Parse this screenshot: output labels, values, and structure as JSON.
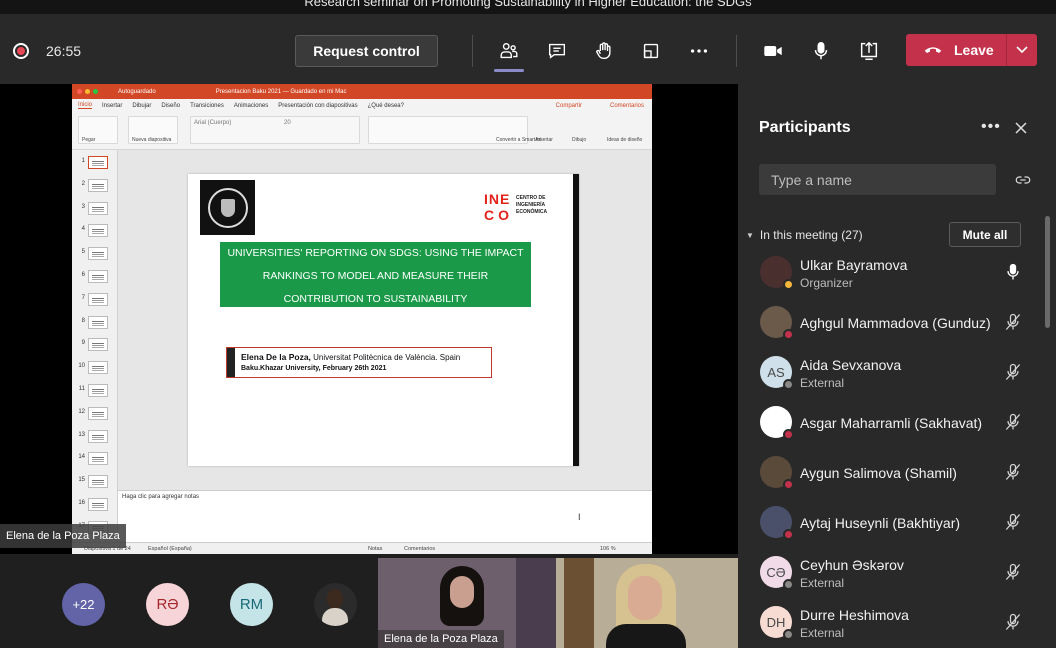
{
  "window": {
    "title": "Research seminar on Promoting Sustainability in Higher Education: the SDGs"
  },
  "toolbar": {
    "timer": "26:55",
    "request_control_label": "Request control",
    "leave_label": "Leave",
    "icons": [
      "people-icon",
      "chat-icon",
      "raise-hand-icon",
      "rooms-icon",
      "more-icon",
      "camera-icon",
      "mic-icon",
      "share-icon"
    ],
    "accent_color": "#6264a7",
    "leave_color": "#c4314b"
  },
  "presentation": {
    "autosave_label": "Autoguardado",
    "doc_title": "Presentacion Baku 2021 — Guardado en mi Mac",
    "tabs": [
      "Inicio",
      "Insertar",
      "Dibujar",
      "Diseño",
      "Transiciones",
      "Animaciones",
      "Presentación con diapositivas",
      "¿Qué desea?"
    ],
    "share_label": "Compartir",
    "comments_label": "Comentarios",
    "font_name": "Arial (Cuerpo)",
    "font_size": "20",
    "ribbon_labels": [
      "Pegar",
      "Nueva diapositiva",
      "Convertir a SmartArt",
      "Insertar",
      "Dibujo",
      "Ideas de diseño"
    ],
    "slide_numbers": [
      "1",
      "2",
      "3",
      "4",
      "5",
      "6",
      "7",
      "8",
      "9",
      "10",
      "11",
      "12",
      "13",
      "14",
      "15",
      "16",
      "17"
    ],
    "slide": {
      "logo_main_line1": "INE",
      "logo_main_line2": "CO",
      "logo_text": "CENTRO DE INGENIERÍA ECONÓMICA",
      "title": "UNIVERSITIES' REPORTING ON SDGS: USING THE IMPACT RANKINGS TO MODEL AND MEASURE THEIR CONTRIBUTION TO  SUSTAINABILITY",
      "author_name": "Elena De la Poza,",
      "author_affiliation": "Universitat Politècnica de València. Spain",
      "author_line2": "Baku.Khazar University, February 26th 2021",
      "green_color": "#1a9a48"
    },
    "notes_placeholder": "Haga clic para agregar notas",
    "status": {
      "slide_of": "Diapositiva 1 de 24",
      "language": "Español (España)",
      "notes": "Notas",
      "comments": "Comentarios",
      "zoom": "106 %"
    }
  },
  "presenter_name": "Elena de la Poza Plaza",
  "bottom_strip": {
    "overflow_count": "+22",
    "initials": [
      "RƏ",
      "RM"
    ],
    "video_tiles": [
      {
        "name": "Elena de la Poza Plaza"
      }
    ]
  },
  "participants_panel": {
    "title": "Participants",
    "search_placeholder": "Type a name",
    "section_label": "In this meeting (27)",
    "mute_all_label": "Mute all",
    "people": [
      {
        "name": "Ulkar Bayramova",
        "role": "Organizer",
        "initials": "",
        "avatar_color": "#4a2f2f",
        "status_color": "#f8b73a",
        "mic": "on"
      },
      {
        "name": "Aghgul Mammadova (Gunduz)",
        "role": "",
        "initials": "",
        "avatar_color": "#6b5a4a",
        "status_color": "#c4314b",
        "mic": "off"
      },
      {
        "name": "Aida Sevxanova",
        "role": "External",
        "initials": "AS",
        "avatar_color": "#cfe0ea",
        "status_color": "#8a8886",
        "mic": "off"
      },
      {
        "name": "Asgar Maharramli (Sakhavat)",
        "role": "",
        "initials": "",
        "avatar_color": "#ffffff",
        "status_color": "#c4314b",
        "mic": "off"
      },
      {
        "name": "Aygun Salimova (Shamil)",
        "role": "",
        "initials": "",
        "avatar_color": "#5a4a3a",
        "status_color": "#c4314b",
        "mic": "off"
      },
      {
        "name": "Aytaj Huseynli (Bakhtiyar)",
        "role": "",
        "initials": "",
        "avatar_color": "#4a4f6a",
        "status_color": "#c4314b",
        "mic": "off"
      },
      {
        "name": "Ceyhun Əskərov",
        "role": "External",
        "initials": "CƏ",
        "avatar_color": "#f1dbe9",
        "status_color": "#8a8886",
        "mic": "off"
      },
      {
        "name": "Durre Heshimova",
        "role": "External",
        "initials": "DH",
        "avatar_color": "#f6dcd2",
        "status_color": "#8a8886",
        "mic": "off"
      }
    ]
  }
}
